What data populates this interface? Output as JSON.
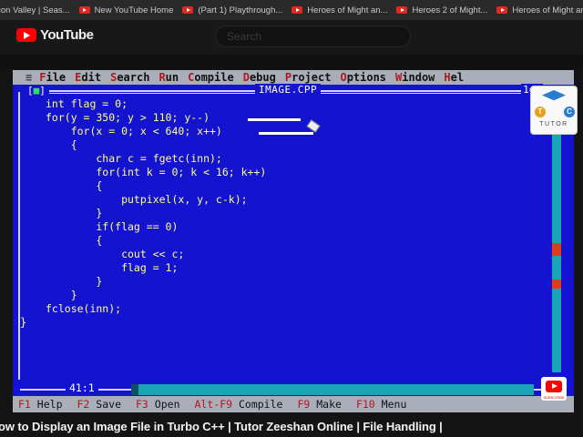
{
  "bookmarks": [
    {
      "label": "icon Valley | Seas...",
      "icon": "bookmark-favicon"
    },
    {
      "label": "New YouTube Home",
      "icon": "youtube-icon"
    },
    {
      "label": "(Part 1) Playthrough...",
      "icon": "youtube-icon"
    },
    {
      "label": "Heroes of Might an...",
      "icon": "youtube-icon"
    },
    {
      "label": "Heroes 2 of Might...",
      "icon": "youtube-icon"
    },
    {
      "label": "Heroes of Might an",
      "icon": "youtube-icon"
    }
  ],
  "youtube": {
    "logo_text": "YouTube",
    "search_placeholder": "Search"
  },
  "ide": {
    "menu": [
      {
        "hotkey": "F",
        "rest": "ile"
      },
      {
        "hotkey": "E",
        "rest": "dit"
      },
      {
        "hotkey": "S",
        "rest": "earch"
      },
      {
        "hotkey": "R",
        "rest": "un"
      },
      {
        "hotkey": "C",
        "rest": "ompile"
      },
      {
        "hotkey": "D",
        "rest": "ebug"
      },
      {
        "hotkey": "P",
        "rest": "roject"
      },
      {
        "hotkey": "O",
        "rest": "ptions"
      },
      {
        "hotkey": "W",
        "rest": "indow"
      },
      {
        "hotkey": "H",
        "rest": "el"
      }
    ],
    "system_menu": "≡",
    "close_box": "■",
    "file_name": "IMAGE.CPP",
    "window_number": "1=[",
    "code_lines": [
      "int flag = 0;",
      "for(y = 350; y > 110; y--)",
      "    for(x = 0; x < 640; x++)",
      "    {",
      "        char c = fgetc(inn);",
      "        for(int k = 0; k < 16; k++)",
      "        {",
      "            putpixel(x, y, c-k);",
      "        }",
      "        if(flag == 0)",
      "        {",
      "            cout << c;",
      "            flag = 1;",
      "        }",
      "    }",
      "fclose(inn);"
    ],
    "closing_brace": "}",
    "cursor_position": "41:1",
    "function_keys": [
      {
        "key": "F1",
        "label": "Help"
      },
      {
        "key": "F2",
        "label": "Save"
      },
      {
        "key": "F3",
        "label": "Open"
      },
      {
        "key": "Alt-F9",
        "label": "Compile"
      },
      {
        "key": "F9",
        "label": "Make"
      },
      {
        "key": "F10",
        "label": "Menu"
      }
    ]
  },
  "overlay": {
    "tutor_letters": [
      "T",
      "C"
    ],
    "tutor_word": "TUTOR",
    "subscribe_label": "SUBSCRIBE"
  },
  "video": {
    "title": "ow to Display an Image File in Turbo C++ | Tutor Zeeshan Online | File Handling |"
  },
  "colors": {
    "ide_background": "#1414d0",
    "code_text": "#ffff8a",
    "menu_bar": "#a9aeba",
    "hotkey": "#b8161b",
    "scrollbar": "#18a6b7"
  }
}
